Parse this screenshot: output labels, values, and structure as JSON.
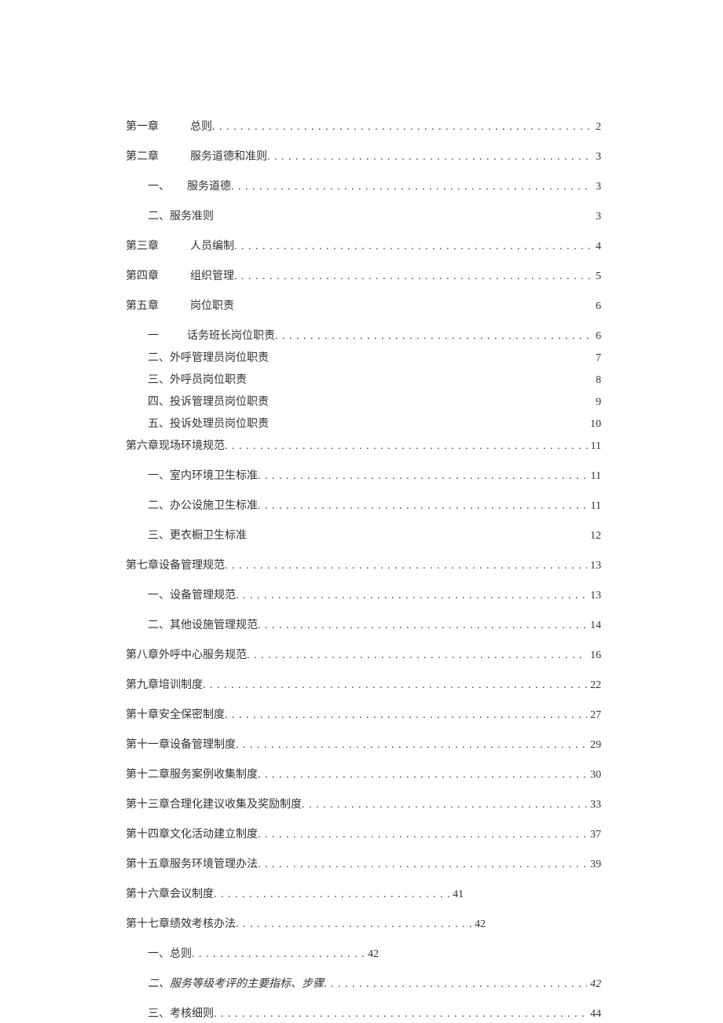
{
  "toc": [
    {
      "label": "第一章",
      "gap": 36,
      "title": "总则",
      "page": "2",
      "leader": true,
      "labelSpace": true
    },
    {
      "label": "第二章",
      "gap": 36,
      "title": "服务道德和准则",
      "page": "3",
      "leader": true,
      "labelSpace": true
    },
    {
      "label": "一、",
      "gap": 22,
      "title": "服务道德",
      "page": "3",
      "leader": true,
      "indent": 1
    },
    {
      "label": "",
      "gap": 0,
      "title": "二、服务准则",
      "page": "3",
      "leader": false,
      "indent": 1
    },
    {
      "label": "第三章",
      "gap": 36,
      "title": "人员编制",
      "page": "4",
      "leader": true,
      "labelSpace": true
    },
    {
      "label": "第四章",
      "gap": 36,
      "title": "组织管理",
      "page": "5",
      "leader": true,
      "labelSpace": true
    },
    {
      "label": "第五章",
      "gap": 36,
      "title": "岗位职责",
      "page": "6",
      "leader": false,
      "labelSpace": true
    },
    {
      "label": "一",
      "gap": 36,
      "title": "话务班长岗位职责",
      "page": "6",
      "leader": true,
      "indent": 1,
      "tight": true
    },
    {
      "label": "",
      "gap": 0,
      "title": "二、外呼管理员岗位职责",
      "page": "7",
      "leader": false,
      "indent": 1,
      "tight": true
    },
    {
      "label": "",
      "gap": 0,
      "title": "三、外呼员岗位职责",
      "page": "8",
      "leader": false,
      "indent": 1,
      "tight": true
    },
    {
      "label": "",
      "gap": 0,
      "title": "四、投诉管理员岗位职责",
      "page": "9",
      "leader": false,
      "indent": 1,
      "tight": true
    },
    {
      "label": "",
      "gap": 0,
      "title": "五、投诉处理员岗位职责",
      "page": "10",
      "leader": false,
      "indent": 1,
      "tight": true
    },
    {
      "label": "",
      "gap": 0,
      "title": "第六章现场环境规范 ",
      "page": "11",
      "leader": true
    },
    {
      "label": "",
      "gap": 0,
      "title": "一、室内环境卫生标准",
      "page": "11",
      "leader": true,
      "indent": 2
    },
    {
      "label": "",
      "gap": 0,
      "title": "二、办公设施卫生标准",
      "page": "11",
      "leader": true,
      "indent": 2
    },
    {
      "label": "",
      "gap": 0,
      "title": "三、更衣橱卫生标准",
      "page": "12",
      "leader": false,
      "indent": 2
    },
    {
      "label": "",
      "gap": 0,
      "title": "第七章设备管理规范 ",
      "page": "13",
      "leader": true
    },
    {
      "label": "",
      "gap": 0,
      "title": "一、设备管理规范",
      "page": "13",
      "leader": true,
      "indent": 2
    },
    {
      "label": "",
      "gap": 0,
      "title": "二、其他设施管理规范",
      "page": "14",
      "leader": true,
      "indent": 2
    },
    {
      "label": "",
      "gap": 0,
      "title": "第八章外呼中心服务规范 ",
      "page": "16",
      "leader": true
    },
    {
      "label": "",
      "gap": 0,
      "title": "第九章培训制度 ",
      "page": "22",
      "leader": true
    },
    {
      "label": "",
      "gap": 0,
      "title": "第十章安全保密制度 ",
      "page": "27",
      "leader": true
    },
    {
      "label": "",
      "gap": 0,
      "title": "第十一章设备管理制度 ",
      "page": "29",
      "leader": true
    },
    {
      "label": "",
      "gap": 0,
      "title": "第十二章服务案例收集制度 ",
      "page": "30",
      "leader": true
    },
    {
      "label": "",
      "gap": 0,
      "title": "第十三章合理化建议收集及奖励制度 ",
      "page": "33",
      "leader": true
    },
    {
      "label": "",
      "gap": 0,
      "title": "第十四章文化活动建立制度 ",
      "page": "37",
      "leader": true
    },
    {
      "label": "",
      "gap": 0,
      "title": "第十五章服务环境管理办法 ",
      "page": "39",
      "leader": true
    },
    {
      "label": "",
      "gap": 0,
      "title": "第十六章会议制度",
      "page": "41",
      "leader": true,
      "short": 300
    },
    {
      "label": "",
      "gap": 0,
      "title": "第十七章绩效考核办法 ",
      "page": "42",
      "leader": true,
      "short": 300
    },
    {
      "label": "",
      "gap": 0,
      "title": "一、总则 ",
      "page": "42",
      "leader": true,
      "indent": 2,
      "short": 220
    },
    {
      "label": "",
      "gap": 0,
      "title": "二、服务等级考评的主要指标、步骤",
      "page": "42",
      "leader": true,
      "indent": 2,
      "italic": true,
      "italicPage": true
    },
    {
      "label": "",
      "gap": 0,
      "title": "三、考核细则",
      "page": "44",
      "leader": true,
      "indent": 2
    }
  ]
}
